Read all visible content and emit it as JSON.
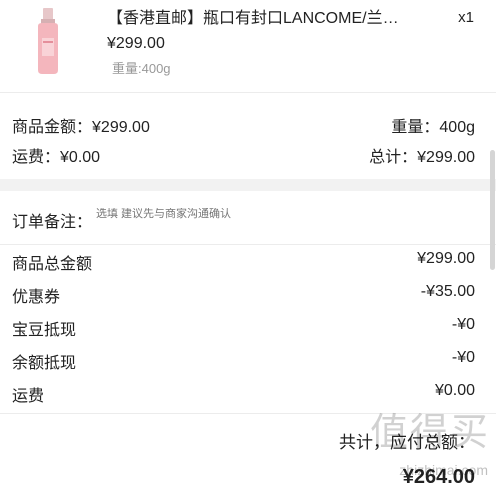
{
  "product": {
    "title": "【香港直邮】瓶口有封口LANCOME/兰…",
    "quantity": "x1",
    "price": "¥299.00",
    "weight": "重量:400g",
    "image_icon": "lotion-bottle-icon"
  },
  "summary": {
    "goods_amount_label": "商品金额：",
    "goods_amount_value": "¥299.00",
    "weight_label": "重量：",
    "weight_value": "400g",
    "shipping_label": "运费：",
    "shipping_value": "¥0.00",
    "total_label": "总计：",
    "total_value": "¥299.00"
  },
  "note": {
    "label": "订单备注：",
    "placeholder": "选填 建议先与商家沟通确认"
  },
  "costs": [
    {
      "label": "商品总金额",
      "value": "¥299.00"
    },
    {
      "label": "优惠券",
      "value": "-¥35.00"
    },
    {
      "label": "宝豆抵现",
      "value": "-¥0"
    },
    {
      "label": "余额抵现",
      "value": "-¥0"
    },
    {
      "label": "运费",
      "value": "¥0.00"
    }
  ],
  "payable": {
    "label": "共计，应付总额：",
    "value": "¥264.00"
  },
  "watermark": {
    "text": "值得买",
    "url": "zhizhimai.com"
  },
  "colors": {
    "divider": "#ececec",
    "gap": "#f2f2f2",
    "muted": "#999999"
  }
}
